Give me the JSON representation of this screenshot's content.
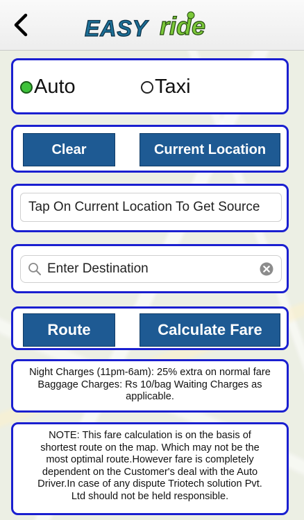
{
  "header": {
    "back_icon": "chevron-left-icon",
    "logo_text": "EASY ride",
    "logo_part1": "EASY",
    "logo_part2": "ride"
  },
  "vehicle": {
    "options": [
      {
        "label": "Auto",
        "selected": true
      },
      {
        "label": "Taxi",
        "selected": false
      }
    ]
  },
  "actions_top": {
    "clear_label": "Clear",
    "current_location_label": "Current Location"
  },
  "source": {
    "value": "Tap On Current Location To Get Source"
  },
  "destination": {
    "placeholder": "Enter Destination",
    "search_icon": "search-icon",
    "clear_icon": "clear-icon"
  },
  "actions_bottom": {
    "route_label": "Route",
    "calculate_label": "Calculate Fare"
  },
  "charges": {
    "line1": "Night Charges (11pm-6am): 25% extra on normal fare",
    "line2": "Baggage Charges: Rs 10/bag Waiting Charges as",
    "line3": "applicable."
  },
  "note": {
    "line1": "NOTE: This fare calculation is on the basis of",
    "line2": "shortest route on the map. Which may not be the",
    "line3": "most optimal route.However fare is completely",
    "line4": "dependent on the Customer's deal with the Auto",
    "line5": "Driver.In case of any dispute Triotech solution Pvt.",
    "line6": "Ltd should not be held responsible."
  },
  "colors": {
    "panel_border": "#1a1fd0",
    "button_bg": "#1e5a93",
    "radio_selected": "#3ec23a"
  }
}
